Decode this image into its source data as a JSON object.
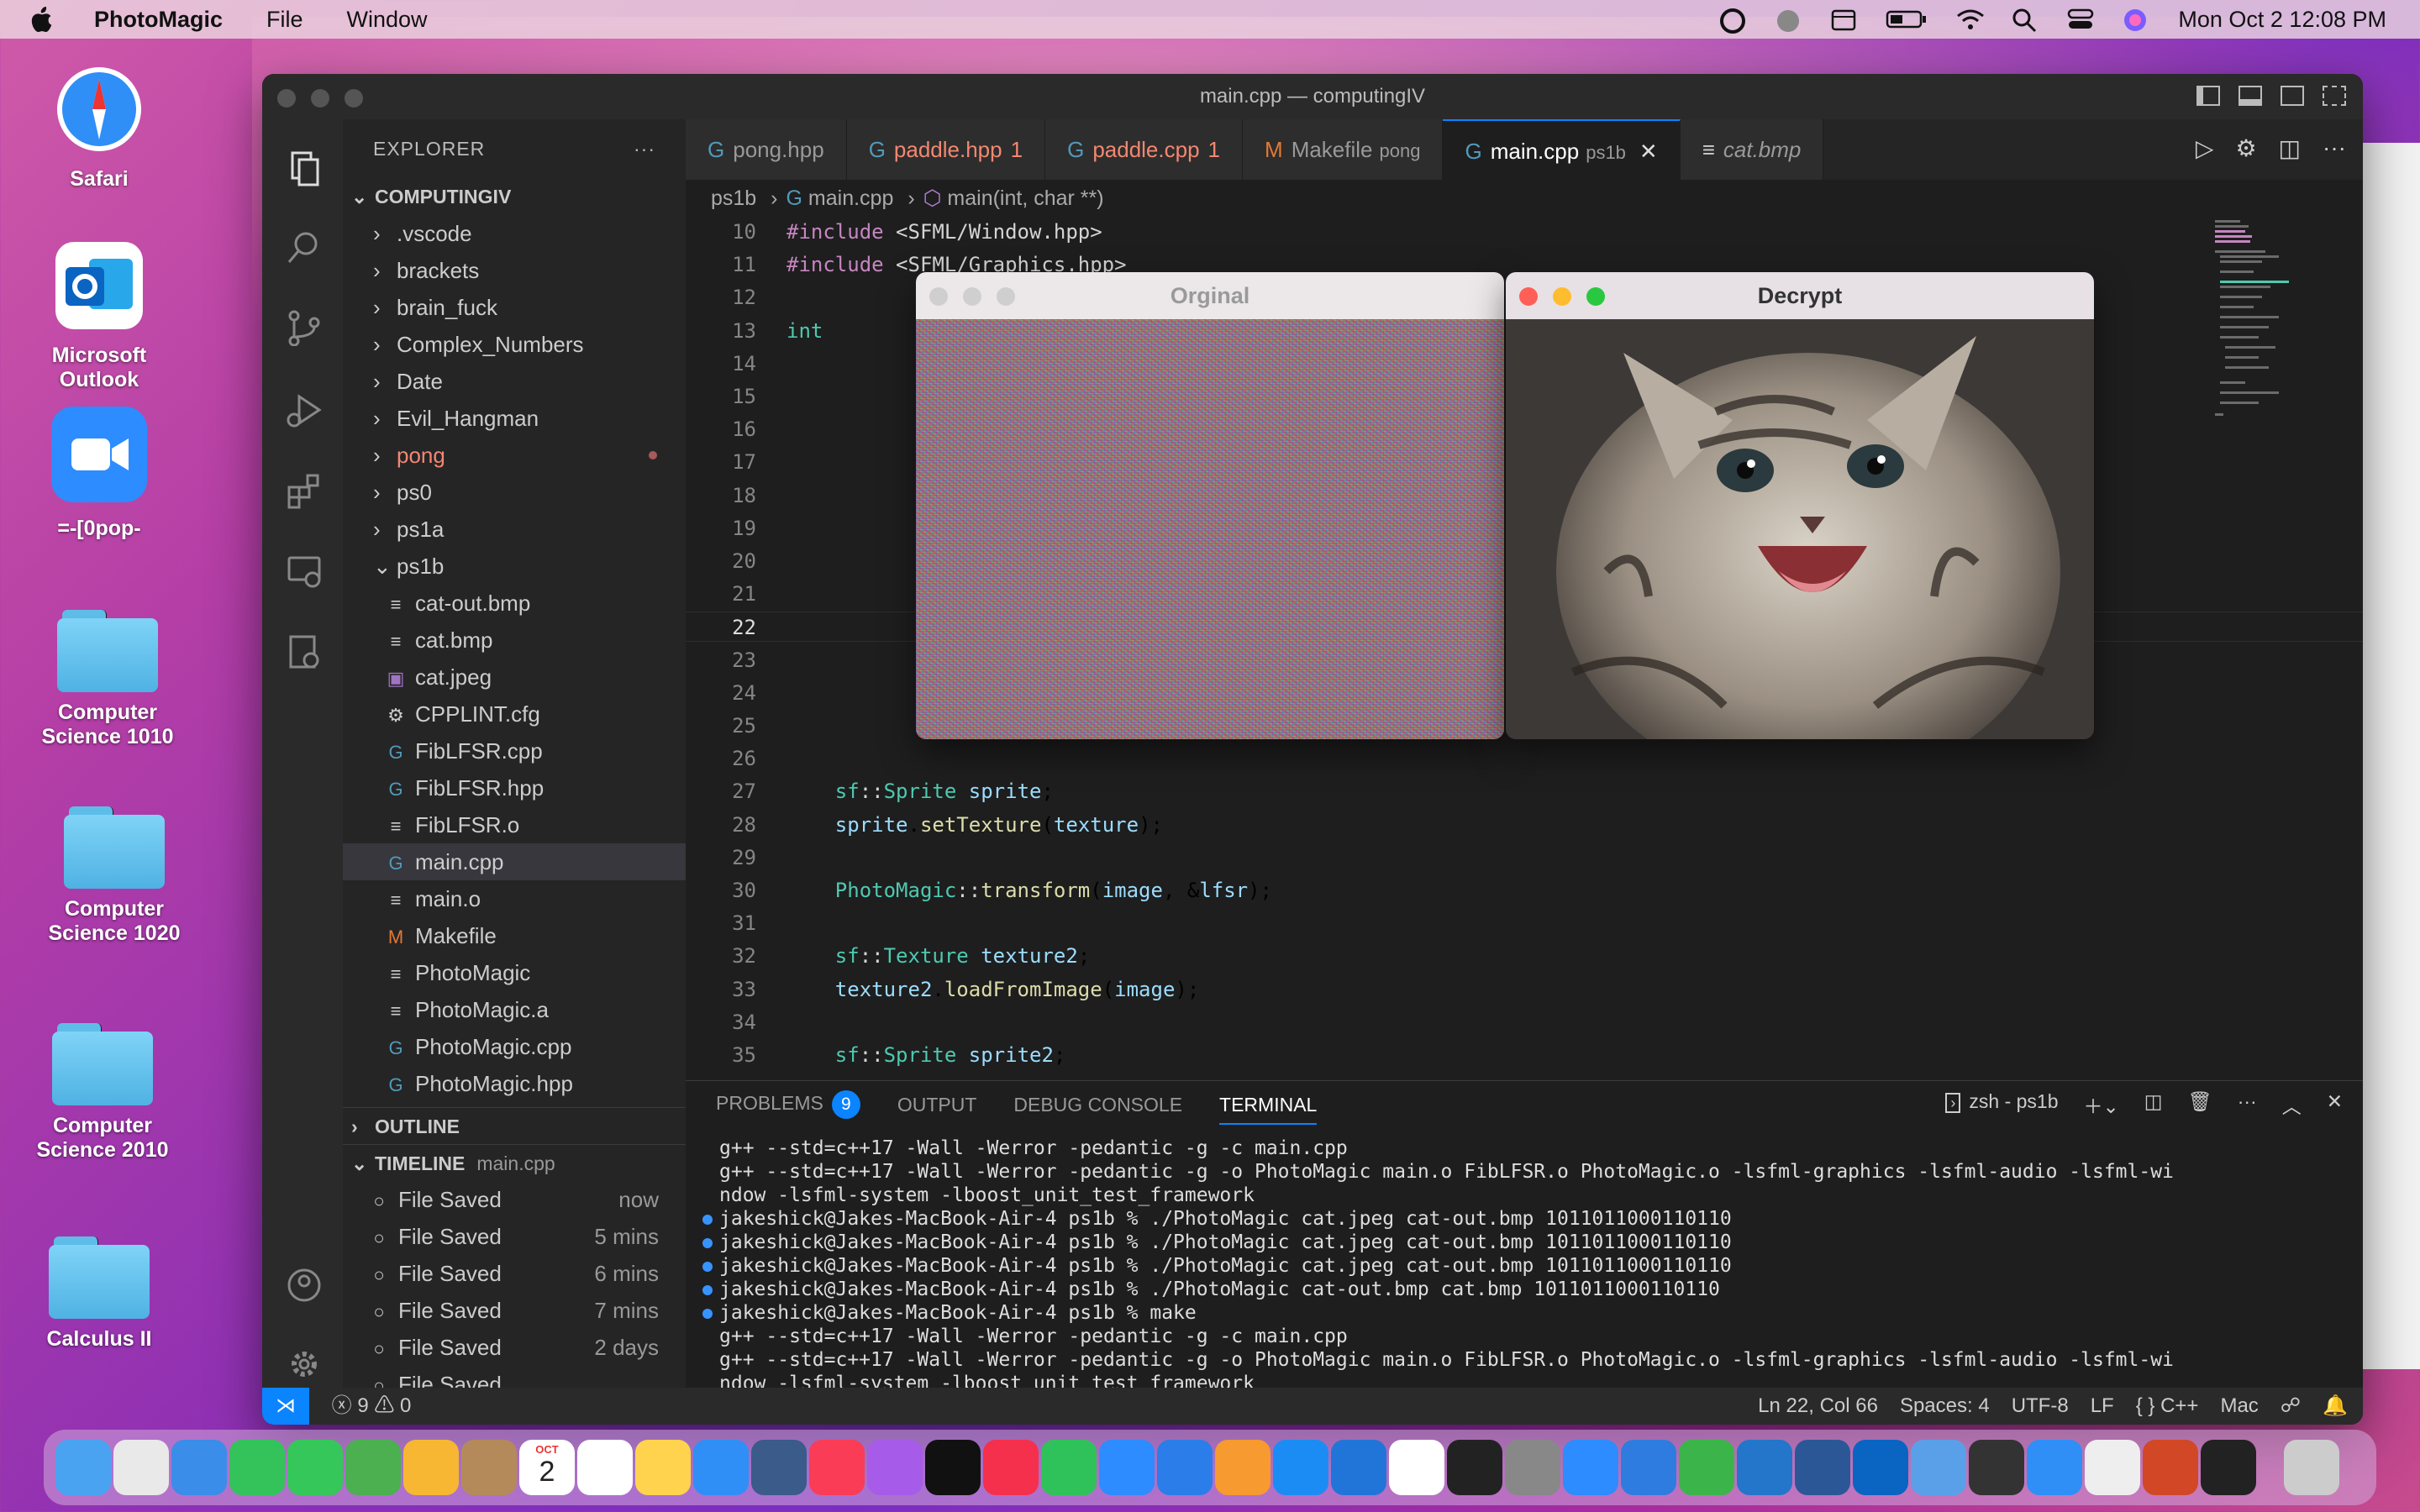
{
  "menubar": {
    "app_name": "PhotoMagic",
    "menus": [
      "File",
      "Window"
    ],
    "datetime": "Mon Oct 2  12:08 PM"
  },
  "desktop": {
    "icons": [
      {
        "label": "Safari",
        "icon": "safari-icon"
      },
      {
        "label": "Microsoft Outlook",
        "icon": "outlook-icon"
      },
      {
        "label": "=-[0pop-",
        "icon": "zoom-icon"
      },
      {
        "label": "Computer Science 1010",
        "icon": "folder-icon"
      },
      {
        "label": "Computer Science 1020",
        "icon": "folder-icon"
      },
      {
        "label": "Computer Science 2010",
        "icon": "folder-icon"
      },
      {
        "label": "Calculus II",
        "icon": "folder-icon"
      }
    ]
  },
  "vscode": {
    "title": "main.cpp — computingIV",
    "explorer": {
      "header": "EXPLORER",
      "root": "COMPUTINGIV",
      "folders": [
        ".vscode",
        "brackets",
        "brain_fuck",
        "Complex_Numbers",
        "Date",
        "Evil_Hangman",
        "pong",
        "ps0",
        "ps1a",
        "ps1b"
      ],
      "files": [
        {
          "name": "cat-out.bmp",
          "icon": "file-lines-icon"
        },
        {
          "name": "cat.bmp",
          "icon": "file-lines-icon"
        },
        {
          "name": "cat.jpeg",
          "icon": "image-file-icon"
        },
        {
          "name": "CPPLINT.cfg",
          "icon": "gear-file-icon"
        },
        {
          "name": "FibLFSR.cpp",
          "icon": "cpp-file-icon"
        },
        {
          "name": "FibLFSR.hpp",
          "icon": "cpp-file-icon"
        },
        {
          "name": "FibLFSR.o",
          "icon": "file-lines-icon"
        },
        {
          "name": "main.cpp",
          "icon": "cpp-file-icon"
        },
        {
          "name": "main.o",
          "icon": "file-lines-icon"
        },
        {
          "name": "Makefile",
          "icon": "makefile-icon"
        },
        {
          "name": "PhotoMagic",
          "icon": "file-lines-icon"
        },
        {
          "name": "PhotoMagic.a",
          "icon": "file-lines-icon"
        },
        {
          "name": "PhotoMagic.cpp",
          "icon": "cpp-file-icon"
        },
        {
          "name": "PhotoMagic.hpp",
          "icon": "cpp-file-icon"
        }
      ],
      "outline": "OUTLINE",
      "timeline": "TIMELINE",
      "timeline_file": "main.cpp",
      "timeline_items": [
        {
          "label": "File Saved",
          "time": "now"
        },
        {
          "label": "File Saved",
          "time": "5 mins"
        },
        {
          "label": "File Saved",
          "time": "6 mins"
        },
        {
          "label": "File Saved",
          "time": "7 mins"
        },
        {
          "label": "File Saved",
          "time": "2 days"
        },
        {
          "label": "File Saved",
          "time": ""
        }
      ]
    },
    "tabs": [
      {
        "name": "pong.hpp",
        "sub": "",
        "count": ""
      },
      {
        "name": "paddle.hpp",
        "sub": "",
        "count": "1"
      },
      {
        "name": "paddle.cpp",
        "sub": "",
        "count": "1"
      },
      {
        "name": "Makefile",
        "sub": "pong",
        "count": ""
      },
      {
        "name": "main.cpp",
        "sub": "ps1b",
        "count": ""
      },
      {
        "name": "cat.bmp",
        "sub": "",
        "count": ""
      }
    ],
    "breadcrumb": [
      "ps1b",
      "main.cpp",
      "main(int, char **)"
    ],
    "code_lines": [
      {
        "n": "10",
        "text": "#include <SFML/Window.hpp>"
      },
      {
        "n": "11",
        "text": "#include <SFML/Graphics.hpp>"
      },
      {
        "n": "12",
        "text": ""
      },
      {
        "n": "13",
        "text": "int"
      },
      {
        "n": "14",
        "text": ""
      },
      {
        "n": "15",
        "text": ""
      },
      {
        "n": "16",
        "text": ""
      },
      {
        "n": "17",
        "text": ""
      },
      {
        "n": "18",
        "text": ""
      },
      {
        "n": "19",
        "text": ""
      },
      {
        "n": "20",
        "text": ""
      },
      {
        "n": "21",
        "text": ""
      },
      {
        "n": "22",
        "text": ""
      },
      {
        "n": "23",
        "text": ""
      },
      {
        "n": "24",
        "text": ""
      },
      {
        "n": "25",
        "text": ""
      },
      {
        "n": "26",
        "text": ""
      },
      {
        "n": "27",
        "text": "    sf::Sprite sprite;"
      },
      {
        "n": "28",
        "text": "    sprite.setTexture(texture);"
      },
      {
        "n": "29",
        "text": ""
      },
      {
        "n": "30",
        "text": "    PhotoMagic::transform(image, &lfsr);"
      },
      {
        "n": "31",
        "text": ""
      },
      {
        "n": "32",
        "text": "    sf::Texture texture2;"
      },
      {
        "n": "33",
        "text": "    texture2.loadFromImage(image);"
      },
      {
        "n": "34",
        "text": ""
      },
      {
        "n": "35",
        "text": "    sf::Sprite sprite2;"
      }
    ],
    "panel_tabs": [
      "PROBLEMS",
      "OUTPUT",
      "DEBUG CONSOLE",
      "TERMINAL"
    ],
    "problems_count": "9",
    "terminal_name": "zsh - ps1b",
    "terminal_lines": [
      {
        "dot": "",
        "text": "g++ --std=c++17 -Wall -Werror -pedantic -g -c main.cpp"
      },
      {
        "dot": "",
        "text": "g++ --std=c++17 -Wall -Werror -pedantic -g -o PhotoMagic main.o FibLFSR.o PhotoMagic.o -lsfml-graphics -lsfml-audio -lsfml-wi"
      },
      {
        "dot": "",
        "text": "ndow -lsfml-system -lboost_unit_test_framework"
      },
      {
        "dot": "blue",
        "text": "jakeshick@Jakes-MacBook-Air-4 ps1b % ./PhotoMagic cat.jpeg cat-out.bmp 1011011000110110"
      },
      {
        "dot": "blue",
        "text": "jakeshick@Jakes-MacBook-Air-4 ps1b % ./PhotoMagic cat.jpeg cat-out.bmp 1011011000110110"
      },
      {
        "dot": "blue",
        "text": "jakeshick@Jakes-MacBook-Air-4 ps1b % ./PhotoMagic cat.jpeg cat-out.bmp 1011011000110110"
      },
      {
        "dot": "blue",
        "text": "jakeshick@Jakes-MacBook-Air-4 ps1b % ./PhotoMagic cat-out.bmp cat.bmp 1011011000110110"
      },
      {
        "dot": "blue",
        "text": "jakeshick@Jakes-MacBook-Air-4 ps1b % make"
      },
      {
        "dot": "",
        "text": "g++ --std=c++17 -Wall -Werror -pedantic -g -c main.cpp"
      },
      {
        "dot": "",
        "text": "g++ --std=c++17 -Wall -Werror -pedantic -g -o PhotoMagic main.o FibLFSR.o PhotoMagic.o -lsfml-graphics -lsfml-audio -lsfml-wi"
      },
      {
        "dot": "",
        "text": "ndow -lsfml-system -lboost_unit_test_framework"
      },
      {
        "dot": "hollow",
        "text": "jakeshick@Jakes-MacBook-Air-4 ps1b % ./PhotoMagic cat-out.bmp cat.bmp 1011011000110110"
      },
      {
        "dot": "",
        "text": "▯"
      }
    ],
    "status": {
      "errors": "9",
      "warnings": "0",
      "position": "Ln 22, Col 66",
      "spaces": "Spaces: 4",
      "encoding": "UTF-8",
      "eol": "LF",
      "language": "C++",
      "platform": "Mac"
    }
  },
  "windows": {
    "original_title": "Orginal",
    "decrypt_title": "Decrypt"
  },
  "dock": {
    "calendar_month": "OCT",
    "calendar_day": "2",
    "apps": [
      "finder-icon",
      "launchpad-icon",
      "mail-icon",
      "facetime-icon",
      "messages-icon",
      "maps-icon",
      "photos-icon",
      "contacts-icon",
      "calendar-icon",
      "reminders-icon",
      "notes-icon",
      "safari-icon",
      "quicktime-icon",
      "music-icon",
      "podcasts-icon",
      "appletv-icon",
      "news-icon",
      "numbers-icon",
      "zoom-icon",
      "keynote-icon",
      "pages-icon",
      "appstore-icon",
      "xcode-icon",
      "chrome-icon",
      "terminal-icon",
      "system-settings-icon",
      "zoom-app-icon",
      "onedrive-icon",
      "icloud-icon",
      "vscode-icon",
      "word-icon",
      "outlook-icon",
      "network-icon",
      "console-icon",
      "preview-icon",
      "textedit-icon",
      "powerpoint-icon",
      "terminal-window-icon",
      "trash-icon"
    ]
  },
  "colors": {
    "accent": "#0a84ff",
    "modified": "#f48771",
    "status_bg": "#2a2a2a"
  }
}
